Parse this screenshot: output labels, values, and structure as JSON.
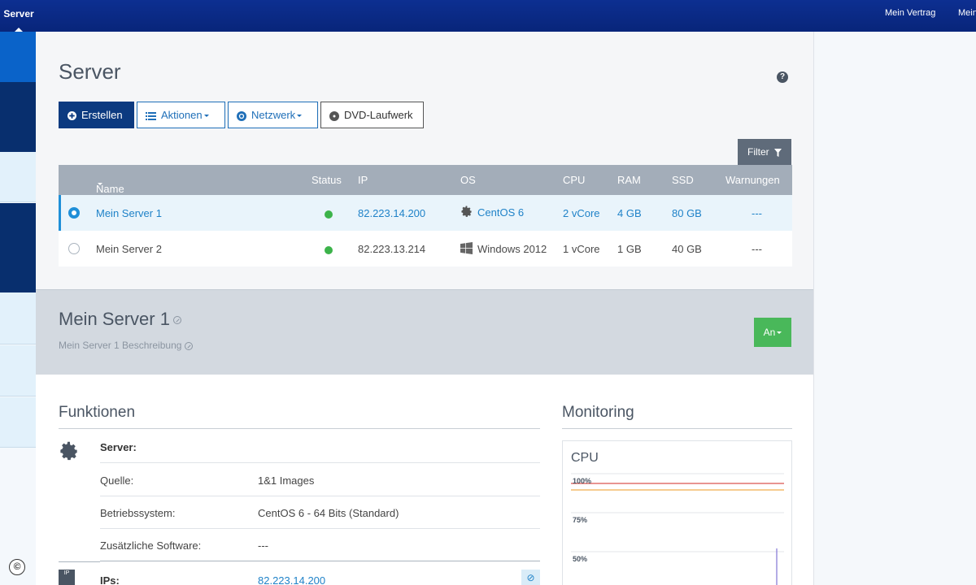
{
  "topbar": {
    "active_tab": "Server",
    "links": [
      "Mein Vertrag",
      "Mein"
    ]
  },
  "sidebar": {
    "blocks": [
      {
        "color": "#0a63c9"
      },
      {
        "color": "#082f6e"
      },
      {
        "color": "#e2f1fb"
      },
      {
        "color": "#082f6e"
      },
      {
        "color": "#e2f1fb"
      },
      {
        "color": "#e2f1fb"
      },
      {
        "color": "#e2f1fb"
      }
    ],
    "copyright": "©"
  },
  "page": {
    "title": "Server",
    "help": "?"
  },
  "toolbar": {
    "create": "Erstellen",
    "actions": "Aktionen",
    "network": "Netzwerk",
    "dvd": "DVD-Laufwerk",
    "filter": "Filter"
  },
  "table": {
    "headers": {
      "name": "Name",
      "status": "Status",
      "ip": "IP",
      "os": "OS",
      "cpu": "CPU",
      "ram": "RAM",
      "ssd": "SSD",
      "warnings": "Warnungen"
    },
    "rows": [
      {
        "name": "Mein Server 1",
        "status": "running",
        "ip": "82.223.14.200",
        "os": "CentOS 6",
        "os_icon": "gear-icon",
        "cpu": "2 vCore",
        "ram": "4 GB",
        "ssd": "80 GB",
        "warnings": "---",
        "selected": true
      },
      {
        "name": "Mein Server 2",
        "status": "running",
        "ip": "82.223.13.214",
        "os": "Windows 2012",
        "os_icon": "windows-icon",
        "cpu": "1 vCore",
        "ram": "1 GB",
        "ssd": "40 GB",
        "warnings": "---",
        "selected": false
      }
    ]
  },
  "detail": {
    "title": "Mein Server 1",
    "description": "Mein Server 1 Beschreibung",
    "power_button": "An"
  },
  "functions": {
    "title": "Funktionen",
    "server_label": "Server:",
    "rows": [
      {
        "key": "Quelle:",
        "value": "1&1 Images"
      },
      {
        "key": "Betriebssystem:",
        "value": "CentOS 6 - 64 Bits (Standard)"
      },
      {
        "key": "Zusätzliche Software:",
        "value": "---"
      }
    ],
    "ips_icon_text": "IP",
    "ips_label": "IPs:",
    "ips_value": "82.223.14.200"
  },
  "monitoring": {
    "title": "Monitoring",
    "chart_title": "CPU",
    "ticks": [
      "100%",
      "75%",
      "50%"
    ],
    "colors": {
      "red": "#d9534f",
      "yellow": "#f0ad4e",
      "purple": "#6a5acd"
    }
  }
}
